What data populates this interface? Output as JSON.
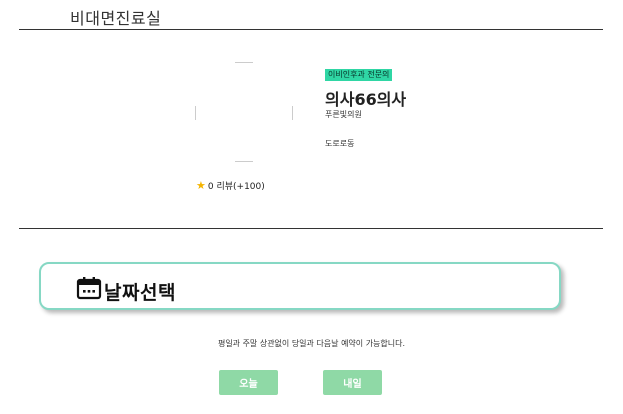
{
  "header": {
    "title": "비대면진료실"
  },
  "doctor": {
    "department": "이비인후과 전문의",
    "name": "의사66의사",
    "clinic": "푸른빛의원",
    "location": "도로로동",
    "review_text": "0 리뷰(+100)",
    "star_icon": "star-icon"
  },
  "date_selection": {
    "title": "날짜선택",
    "icon": "calendar-icon",
    "notice": "평일과 주말 상관없이 당일과 다음날 예약이 가능합니다.",
    "today_label": "오늘",
    "tomorrow_label": "내일"
  },
  "colors": {
    "badge": "#2fd6a4",
    "button": "#8fd9a6",
    "box_border": "#86d8c4",
    "star": "#f4b400"
  }
}
